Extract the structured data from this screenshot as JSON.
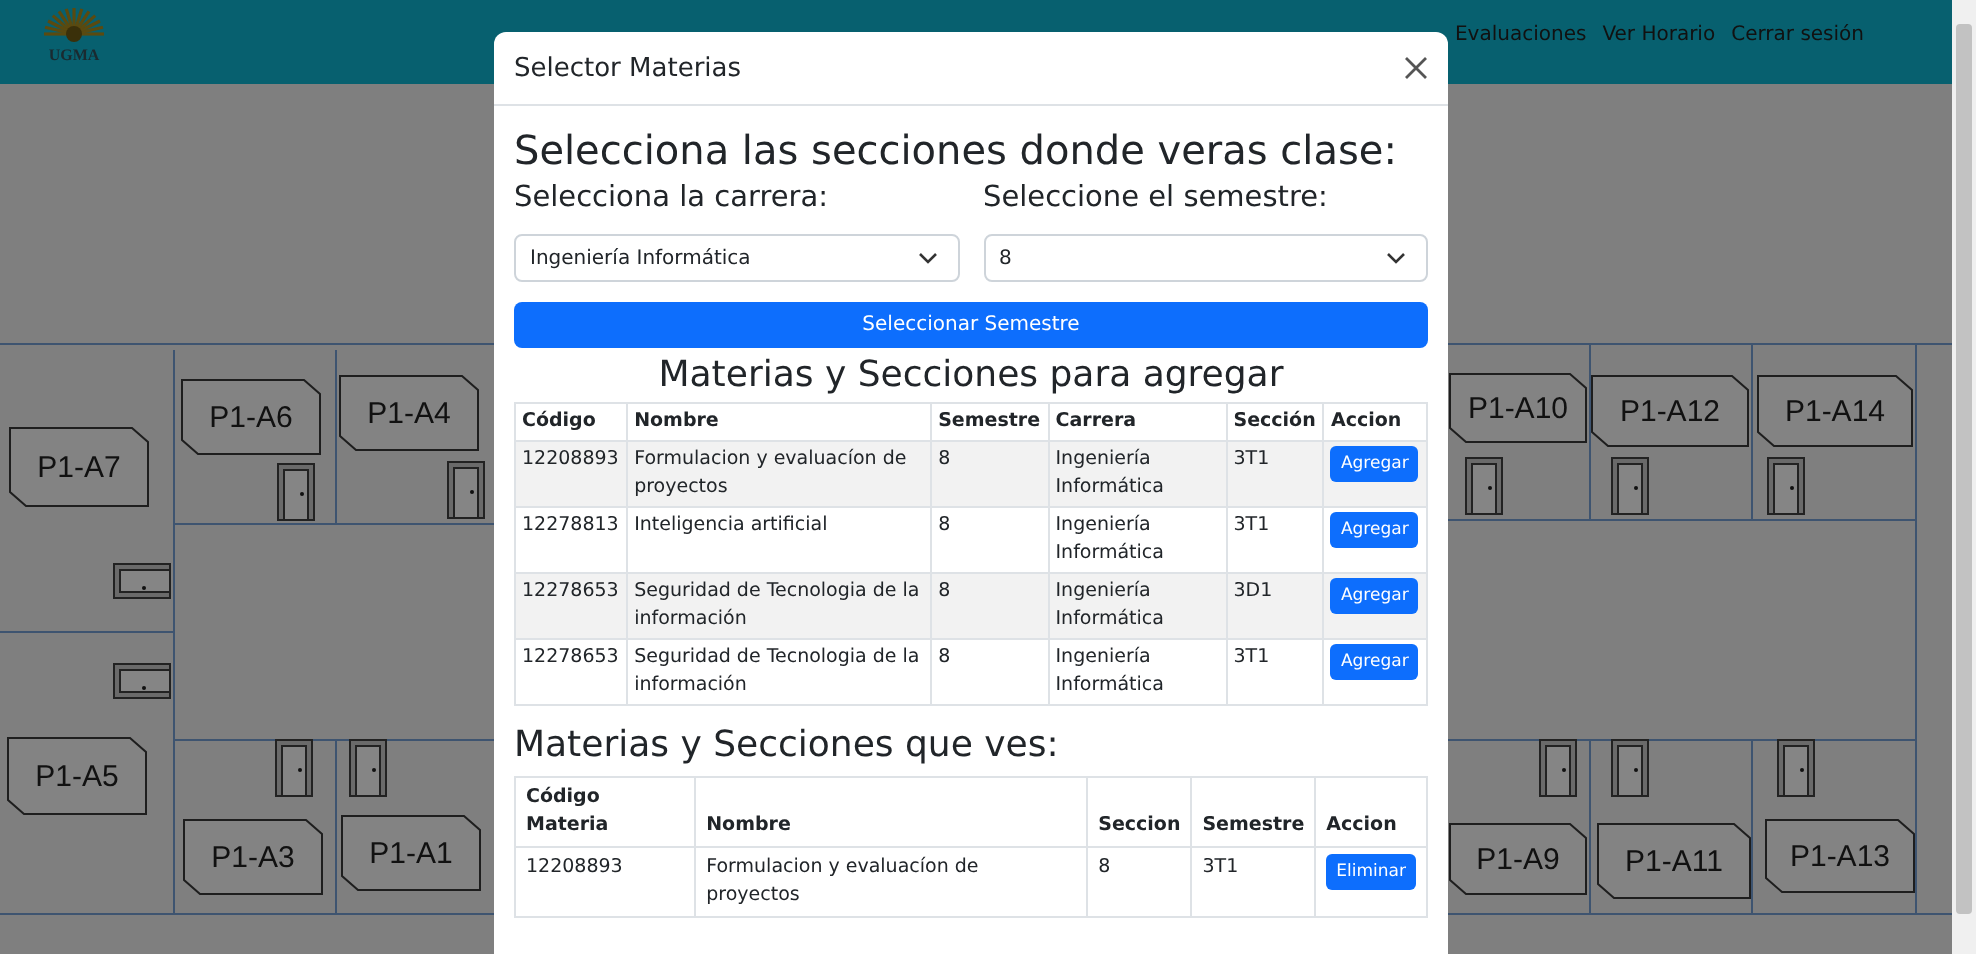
{
  "header": {
    "logo_text": "UGMA",
    "nav": [
      "Evaluaciones",
      "Ver Horario",
      "Cerrar sesión"
    ]
  },
  "floor_plan": {
    "rooms": [
      {
        "label": "P1-A7"
      },
      {
        "label": "P1-A6"
      },
      {
        "label": "P1-A4"
      },
      {
        "label": "P1-A5"
      },
      {
        "label": "P1-A3"
      },
      {
        "label": "P1-A1"
      },
      {
        "label": "P1-A10"
      },
      {
        "label": "P1-A12"
      },
      {
        "label": "P1-A14"
      },
      {
        "label": "P1-A9"
      },
      {
        "label": "P1-A11"
      },
      {
        "label": "P1-A13"
      }
    ]
  },
  "modal": {
    "title": "Selector Materias",
    "heading": "Selecciona las secciones donde veras clase:",
    "career_label": "Selecciona la carrera:",
    "career_value": "Ingeniería Informática",
    "semester_label": "Seleccione el semestre:",
    "semester_value": "8",
    "select_button": "Seleccionar Semestre",
    "available": {
      "title": "Materias y Secciones para agregar",
      "columns": [
        "Código",
        "Nombre",
        "Semestre",
        "Carrera",
        "Sección",
        "Accion"
      ],
      "rows": [
        {
          "cells": [
            "12208893",
            "Formulacion y evaluacíon de proyectos",
            "8",
            "Ingeniería Informática",
            "3T1"
          ],
          "action": "Agregar"
        },
        {
          "cells": [
            "12278813",
            "Inteligencia artificial",
            "8",
            "Ingeniería Informática",
            "3T1"
          ],
          "action": "Agregar"
        },
        {
          "cells": [
            "12278653",
            "Seguridad de Tecnologia de la información",
            "8",
            "Ingeniería Informática",
            "3D1"
          ],
          "action": "Agregar"
        },
        {
          "cells": [
            "12278653",
            "Seguridad de Tecnologia de la información",
            "8",
            "Ingeniería Informática",
            "3T1"
          ],
          "action": "Agregar"
        }
      ]
    },
    "selected": {
      "title": "Materias y Secciones que ves:",
      "columns": [
        "Código Materia",
        "Nombre",
        "Seccion",
        "Semestre",
        "Accion"
      ],
      "rows": [
        {
          "cells": [
            "12208893",
            "Formulacion y evaluacíon de proyectos",
            "8",
            "3T1"
          ],
          "action": "Eliminar"
        }
      ]
    }
  }
}
